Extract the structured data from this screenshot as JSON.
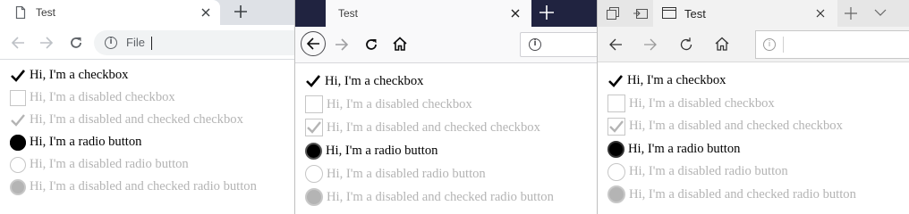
{
  "tab_title": "Test",
  "address_text": "File",
  "info_icon": "i",
  "labels": [
    "Hi, I'm a checkbox",
    "Hi, I'm a disabled checkbox",
    "Hi, I'm a disabled and checked checkbox",
    "Hi, I'm a radio button",
    "Hi, I'm a disabled radio button",
    "Hi, I'm a disabled and checked radio button"
  ],
  "colors": {
    "firefox_tabbar": "#202340",
    "edge_tabbar": "#e6e6e6",
    "disabled_text": "#b4b4b4"
  }
}
